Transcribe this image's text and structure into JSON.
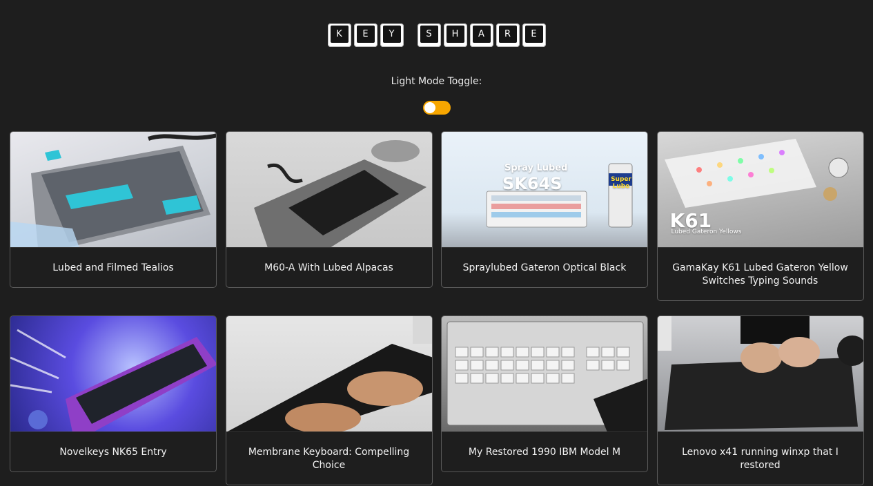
{
  "logo": {
    "words": [
      [
        "K",
        "E",
        "Y"
      ],
      [
        "S",
        "H",
        "A",
        "R",
        "E"
      ]
    ]
  },
  "toggle": {
    "label": "Light Mode Toggle:",
    "accent_color": "#f7a600"
  },
  "cards": [
    {
      "title": "Lubed and Filmed Tealios"
    },
    {
      "title": "M60-A With Lubed Alpacas"
    },
    {
      "title": "Spraylubed Gateron Optical Black",
      "thumb_line1": "Spray Lubed",
      "thumb_line2": "SK64S",
      "thumb_can": "Super Lube"
    },
    {
      "title": "GamaKay K61 Lubed Gateron Yellow Switches Typing Sounds",
      "thumb_line1": "K61",
      "thumb_line2": "Lubed Gateron Yellows"
    },
    {
      "title": "Novelkeys NK65 Entry"
    },
    {
      "title": "Membrane Keyboard: Compelling Choice"
    },
    {
      "title": "My Restored 1990 IBM Model M"
    },
    {
      "title": "Lenovo x41 running winxp that I restored"
    }
  ]
}
